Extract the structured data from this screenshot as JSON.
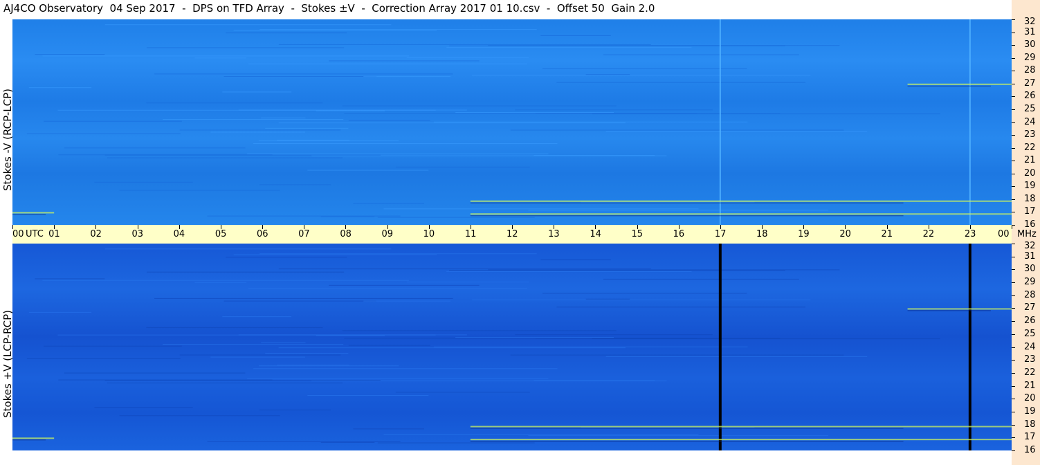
{
  "title": "AJ4CO Observatory  04 Sep 2017  -  DPS on TFD Array  -  Stokes ±V  -  Correction Array 2017 01 10.csv  -  Offset 50  Gain 2.0",
  "chart_data": {
    "type": "heatmap",
    "panels": [
      {
        "name": "top",
        "ylabel": "Stokes -V  (RCP-LCP)"
      },
      {
        "name": "bottom",
        "ylabel": "Stokes +V  (LCP-RCP)"
      }
    ],
    "x_axis": {
      "unit_label": "UTC",
      "ticks": [
        "00",
        "01",
        "02",
        "03",
        "04",
        "05",
        "06",
        "07",
        "08",
        "09",
        "10",
        "11",
        "12",
        "13",
        "14",
        "15",
        "16",
        "17",
        "18",
        "19",
        "20",
        "21",
        "22",
        "23",
        "00"
      ],
      "range_hours": [
        0,
        24
      ]
    },
    "y_axis": {
      "unit_label": "MHz",
      "ticks": [
        32,
        31,
        30,
        29,
        28,
        27,
        26,
        25,
        24,
        23,
        22,
        21,
        20,
        19,
        18,
        17,
        16
      ],
      "range_mhz": [
        16,
        32
      ]
    },
    "colors": {
      "top_base": "#2486ec",
      "bottom_base": "#1a5fdc",
      "rfi_line": "#4fb0ff",
      "gap_line": "#000000",
      "emission": "#c8f060",
      "utc_bar": "#ffffc8",
      "freq_strip": "#fde7cf"
    },
    "features": {
      "vertical_lines_utc": [
        17.0,
        23.0
      ],
      "bottom_gaps_utc": [
        17.0,
        23.0
      ],
      "emission_bands": [
        {
          "t_start": 11.0,
          "t_end": 24.0,
          "f_mhz": 17.9
        },
        {
          "t_start": 11.0,
          "t_end": 24.0,
          "f_mhz": 16.9
        },
        {
          "t_start": 0.0,
          "t_end": 1.0,
          "f_mhz": 17.0
        },
        {
          "t_start": 21.5,
          "t_end": 24.0,
          "f_mhz": 27.0
        }
      ]
    }
  }
}
